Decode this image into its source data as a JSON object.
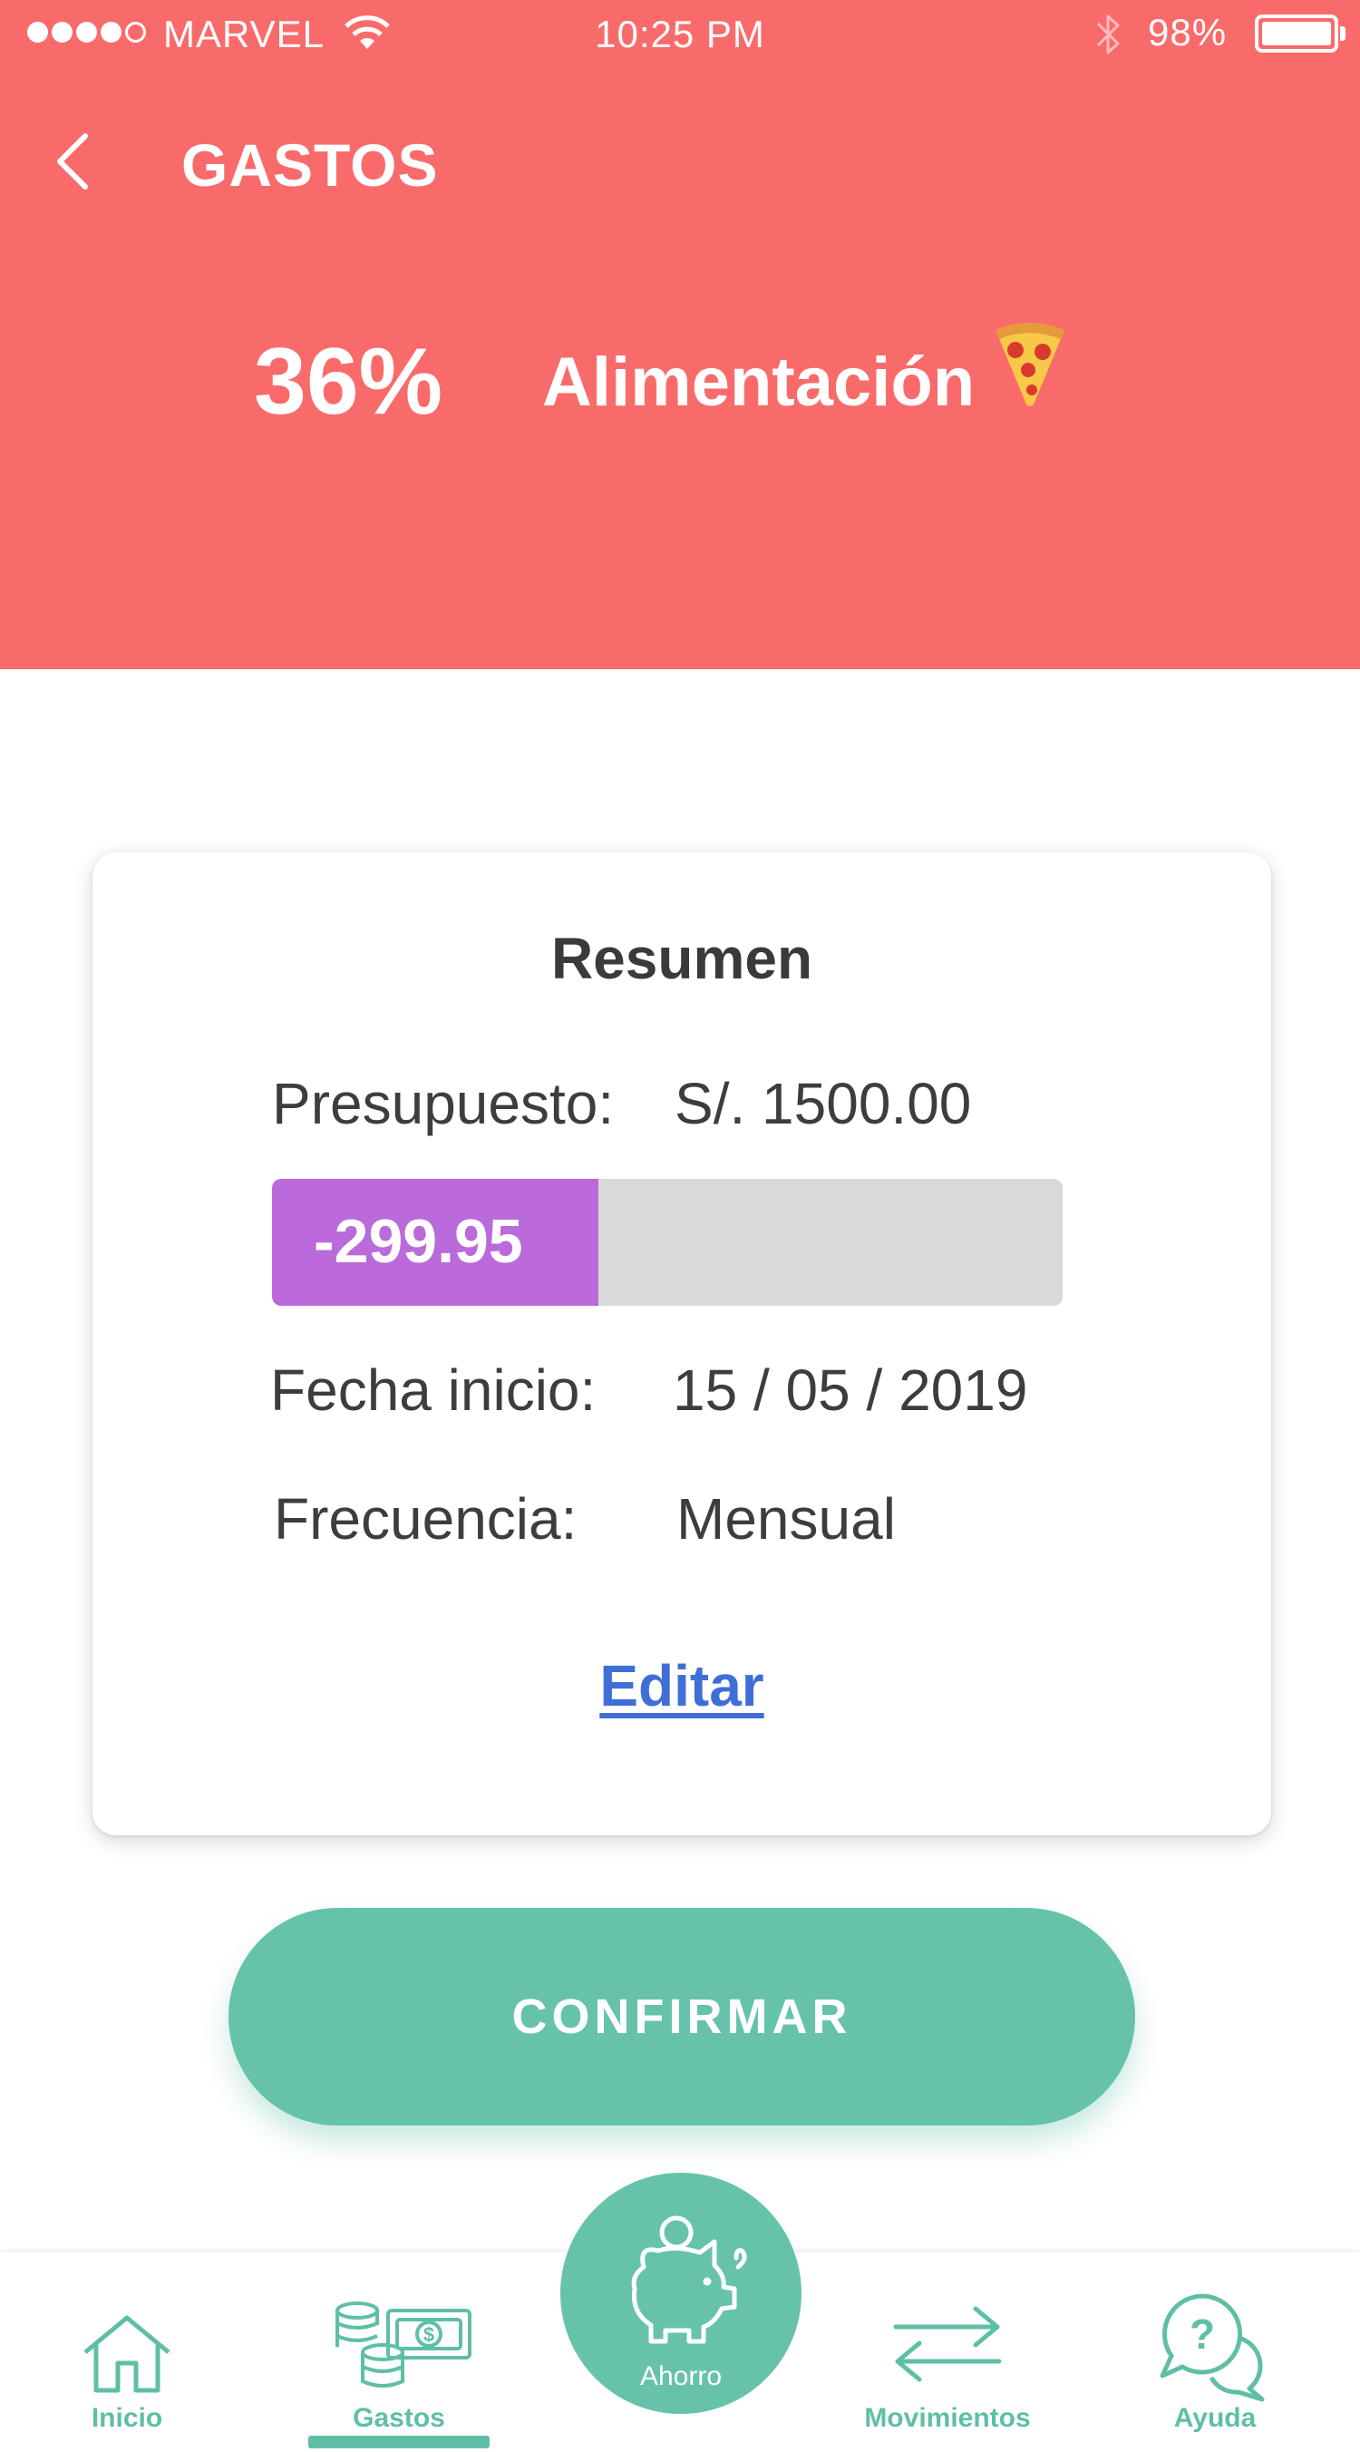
{
  "status_bar": {
    "carrier": "MARVEL",
    "time": "10:25 PM",
    "battery": "98%"
  },
  "header": {
    "title": "GASTOS",
    "percent": "36%",
    "category": "Alimentación",
    "category_icon": "pizza-icon",
    "background_color": "#f96b6b"
  },
  "summary": {
    "title": "Resumen",
    "budget_label": "Presupuesto:",
    "budget_value": "S/. 1500.00",
    "spent_value": "-299.95",
    "spent_fraction": 0.4131,
    "start_label": "Fecha inicio:",
    "start_value": "15 / 05 / 2019",
    "frequency_label": "Frecuencia:",
    "frequency_value": "Mensual",
    "edit_label": "Editar",
    "bar_color": "#ba6adb"
  },
  "confirm_label": "CONFIRMAR",
  "tabbar": {
    "accent_color": "#66c3aa",
    "items": [
      {
        "label": "Inicio",
        "icon": "home-icon"
      },
      {
        "label": "Gastos",
        "icon": "money-icon",
        "active": true
      },
      {
        "label": "Ahorro",
        "icon": "piggy-bank-icon"
      },
      {
        "label": "Movimientos",
        "icon": "transfer-icon"
      },
      {
        "label": "Ayuda",
        "icon": "help-chat-icon"
      }
    ]
  }
}
